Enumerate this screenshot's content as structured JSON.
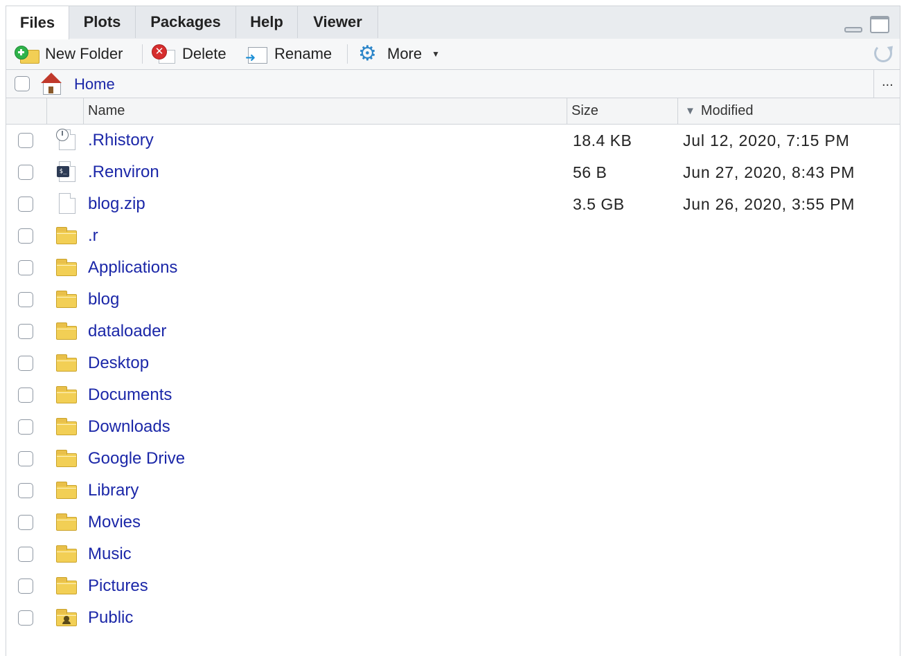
{
  "tabs": [
    {
      "label": "Files",
      "active": true
    },
    {
      "label": "Plots",
      "active": false
    },
    {
      "label": "Packages",
      "active": false
    },
    {
      "label": "Help",
      "active": false
    },
    {
      "label": "Viewer",
      "active": false
    }
  ],
  "toolbar": {
    "new_folder_label": "New Folder",
    "delete_label": "Delete",
    "rename_label": "Rename",
    "more_label": "More"
  },
  "path": {
    "home_label": "Home",
    "more_label": "..."
  },
  "columns": {
    "name": "Name",
    "size": "Size",
    "modified": "Modified"
  },
  "files": [
    {
      "name": ".Rhistory",
      "size": "18.4 KB",
      "modified": "Jul 12, 2020, 7:15 PM",
      "icon": "history-file-icon"
    },
    {
      "name": ".Renviron",
      "size": "56 B",
      "modified": "Jun 27, 2020, 8:43 PM",
      "icon": "terminal-file-icon"
    },
    {
      "name": "blog.zip",
      "size": "3.5 GB",
      "modified": "Jun 26, 2020, 3:55 PM",
      "icon": "blank-file-icon"
    },
    {
      "name": ".r",
      "size": "",
      "modified": "",
      "icon": "folder-icon"
    },
    {
      "name": "Applications",
      "size": "",
      "modified": "",
      "icon": "folder-icon"
    },
    {
      "name": "blog",
      "size": "",
      "modified": "",
      "icon": "folder-icon"
    },
    {
      "name": "dataloader",
      "size": "",
      "modified": "",
      "icon": "folder-icon"
    },
    {
      "name": "Desktop",
      "size": "",
      "modified": "",
      "icon": "folder-icon"
    },
    {
      "name": "Documents",
      "size": "",
      "modified": "",
      "icon": "folder-icon"
    },
    {
      "name": "Downloads",
      "size": "",
      "modified": "",
      "icon": "folder-icon"
    },
    {
      "name": "Google Drive",
      "size": "",
      "modified": "",
      "icon": "folder-icon"
    },
    {
      "name": "Library",
      "size": "",
      "modified": "",
      "icon": "folder-icon"
    },
    {
      "name": "Movies",
      "size": "",
      "modified": "",
      "icon": "folder-icon"
    },
    {
      "name": "Music",
      "size": "",
      "modified": "",
      "icon": "folder-icon"
    },
    {
      "name": "Pictures",
      "size": "",
      "modified": "",
      "icon": "folder-icon"
    },
    {
      "name": "Public",
      "size": "",
      "modified": "",
      "icon": "public-folder-icon"
    }
  ],
  "colors": {
    "link": "#1b27a8",
    "folder": "#f2cf55",
    "border": "#cfd3d8"
  }
}
